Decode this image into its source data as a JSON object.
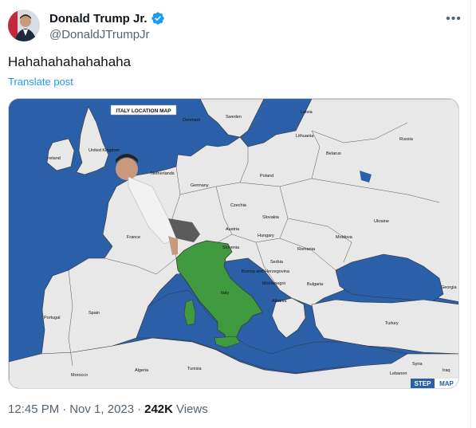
{
  "author": {
    "display_name": "Donald Trump Jr.",
    "handle": "@DonaldJTrumpJr",
    "verified_color": "#1d9bf0"
  },
  "tweet": {
    "text": "Hahahahahahahaha",
    "translate_label": "Translate post"
  },
  "media": {
    "map_title": "ITALY LOCATION MAP",
    "watermark_a": "STEP",
    "watermark_b": "MAP",
    "sea_color": "#2b5fa8",
    "land_color": "#e8e8e8",
    "italy_color": "#3f9a3f",
    "labels": {
      "latvia": "Latvia",
      "sweden": "Sweden",
      "denmark": "Denmark",
      "lithuania": "Lithuania",
      "russia": "Russia",
      "ireland": "Ireland",
      "united_kingdom": "United Kingdom",
      "belarus": "Belarus",
      "netherlands": "Netherlands",
      "poland": "Poland",
      "germany": "Germany",
      "czechia": "Czechia",
      "slovakia": "Slovakia",
      "ukraine": "Ukraine",
      "austria": "Austria",
      "france": "France",
      "hungary": "Hungary",
      "moldova": "Moldova",
      "slovenia": "Slovenia",
      "romania": "Romania",
      "serbia": "Serbia",
      "bosnia": "Bosnia and Herzegovina",
      "montenegro": "Montenegro",
      "bulgaria": "Bulgaria",
      "georgia": "Georgia",
      "italy": "Italy",
      "albania": "Albania",
      "spain": "Spain",
      "portugal": "Portugal",
      "turkey": "Turkey",
      "syria": "Syria",
      "iraq": "Iraq",
      "morocco": "Morocco",
      "algeria": "Algeria",
      "tunisia": "Tunisia",
      "lebanon": "Lebanon"
    }
  },
  "meta": {
    "time": "12:45 PM",
    "separator": "·",
    "date": "Nov 1, 2023",
    "views_count": "242K",
    "views_label": "Views"
  }
}
